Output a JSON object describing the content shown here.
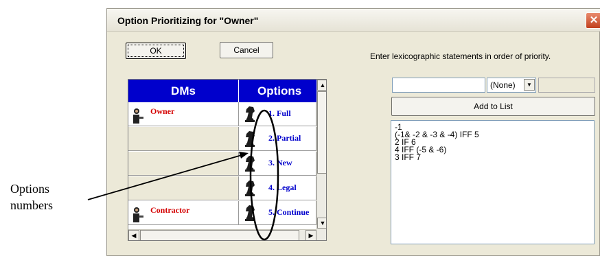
{
  "window": {
    "title": "Option Prioritizing for \"Owner\"",
    "close_glyph": "✕"
  },
  "buttons": {
    "ok": "OK",
    "cancel": "Cancel",
    "add_to_list": "Add to List"
  },
  "instruction": "Enter lexicographic statements in order of priority.",
  "grid": {
    "headers": {
      "dms": "DMs",
      "options": "Options"
    },
    "rows": [
      {
        "dm": "Owner",
        "option": "1. Full"
      },
      {
        "dm": "",
        "option": "2. Partial"
      },
      {
        "dm": "",
        "option": "3. New"
      },
      {
        "dm": "",
        "option": "4. Legal"
      },
      {
        "dm": "Contractor",
        "option": "5. Continue"
      }
    ]
  },
  "select": {
    "value": "(None)"
  },
  "statements": [
    "-1",
    "(-1& -2 & -3 & -4) IFF 5",
    "2 IF 6",
    "4 IFF (-5 & -6)",
    "3  IFF 7"
  ],
  "annotation": {
    "line1": "Options",
    "line2": "numbers"
  },
  "icons": {
    "dm": "person-icon",
    "option": "chess-knight-icon",
    "scroll_up": "▲",
    "scroll_down": "▼",
    "scroll_left": "◀",
    "scroll_right": "▶"
  },
  "colors": {
    "header_bg": "#0000cc",
    "dm_text": "#d40000",
    "option_text": "#0000cc"
  }
}
